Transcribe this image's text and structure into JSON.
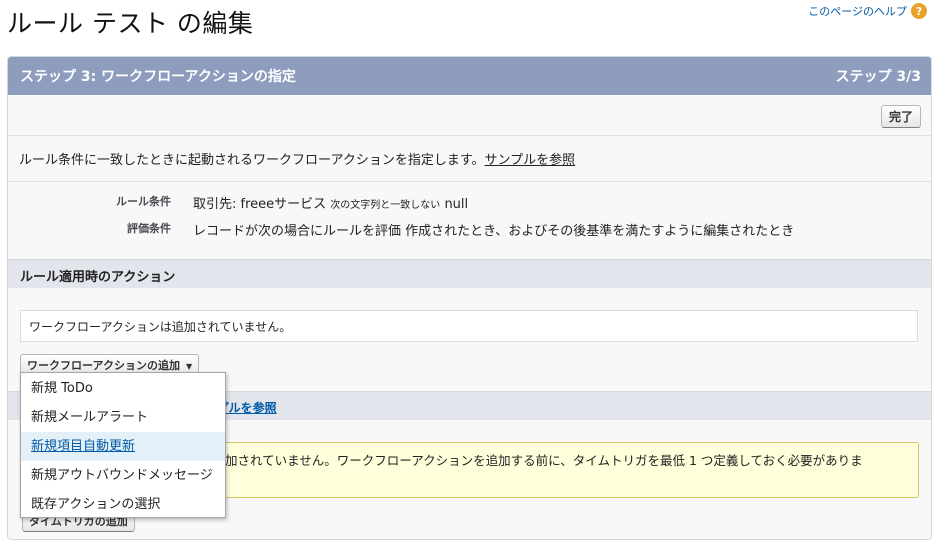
{
  "header": {
    "title": "ルール テスト の編集",
    "help_link": "このページのヘルプ",
    "help_icon": "question-circle-icon"
  },
  "panel": {
    "step_title": "ステップ 3: ワークフローアクションの指定",
    "step_indicator": "ステップ 3/3",
    "finish_button": "完了",
    "description": "ルール条件に一致したときに起動されるワークフローアクションを指定します。",
    "sample_link": "サンプルを参照",
    "rule_criteria_label": "ルール条件",
    "rule_criteria_value": "取引先: freeeサービス",
    "rule_criteria_op": "次の文字列と一致しない",
    "rule_criteria_target": "null",
    "eval_criteria_label": "評価条件",
    "eval_criteria_value": "レコードが次の場合にルールを評価 作成されたとき、およびその後基準を満たすように編集されたとき"
  },
  "immediate_actions": {
    "heading": "ルール適用時のアクション",
    "empty_message": "ワークフローアクションは追加されていません。",
    "add_button": "ワークフローアクションの追加",
    "caret": "▼"
  },
  "time_dependent": {
    "sample_link": "ンプルを参照",
    "warning_line1": "加されていません。ワークフローアクションを追加する前に、タイムトリガを最低 1 つ定義しておく必要がありま",
    "warning_line2": "",
    "add_trigger_button": "タイムトリガの追加"
  },
  "dropdown": {
    "items": [
      {
        "label": "新規 ToDo"
      },
      {
        "label": "新規メールアラート"
      },
      {
        "label": "新規項目自動更新"
      },
      {
        "label": "新規アウトバウンドメッセージ"
      },
      {
        "label": "既存アクションの選択"
      }
    ],
    "highlighted_index": 2
  },
  "colors": {
    "header_bg": "#8e9dbe",
    "link": "#015ba7",
    "warning_bg": "#ffffdc",
    "help_icon": "#e8a22a"
  }
}
